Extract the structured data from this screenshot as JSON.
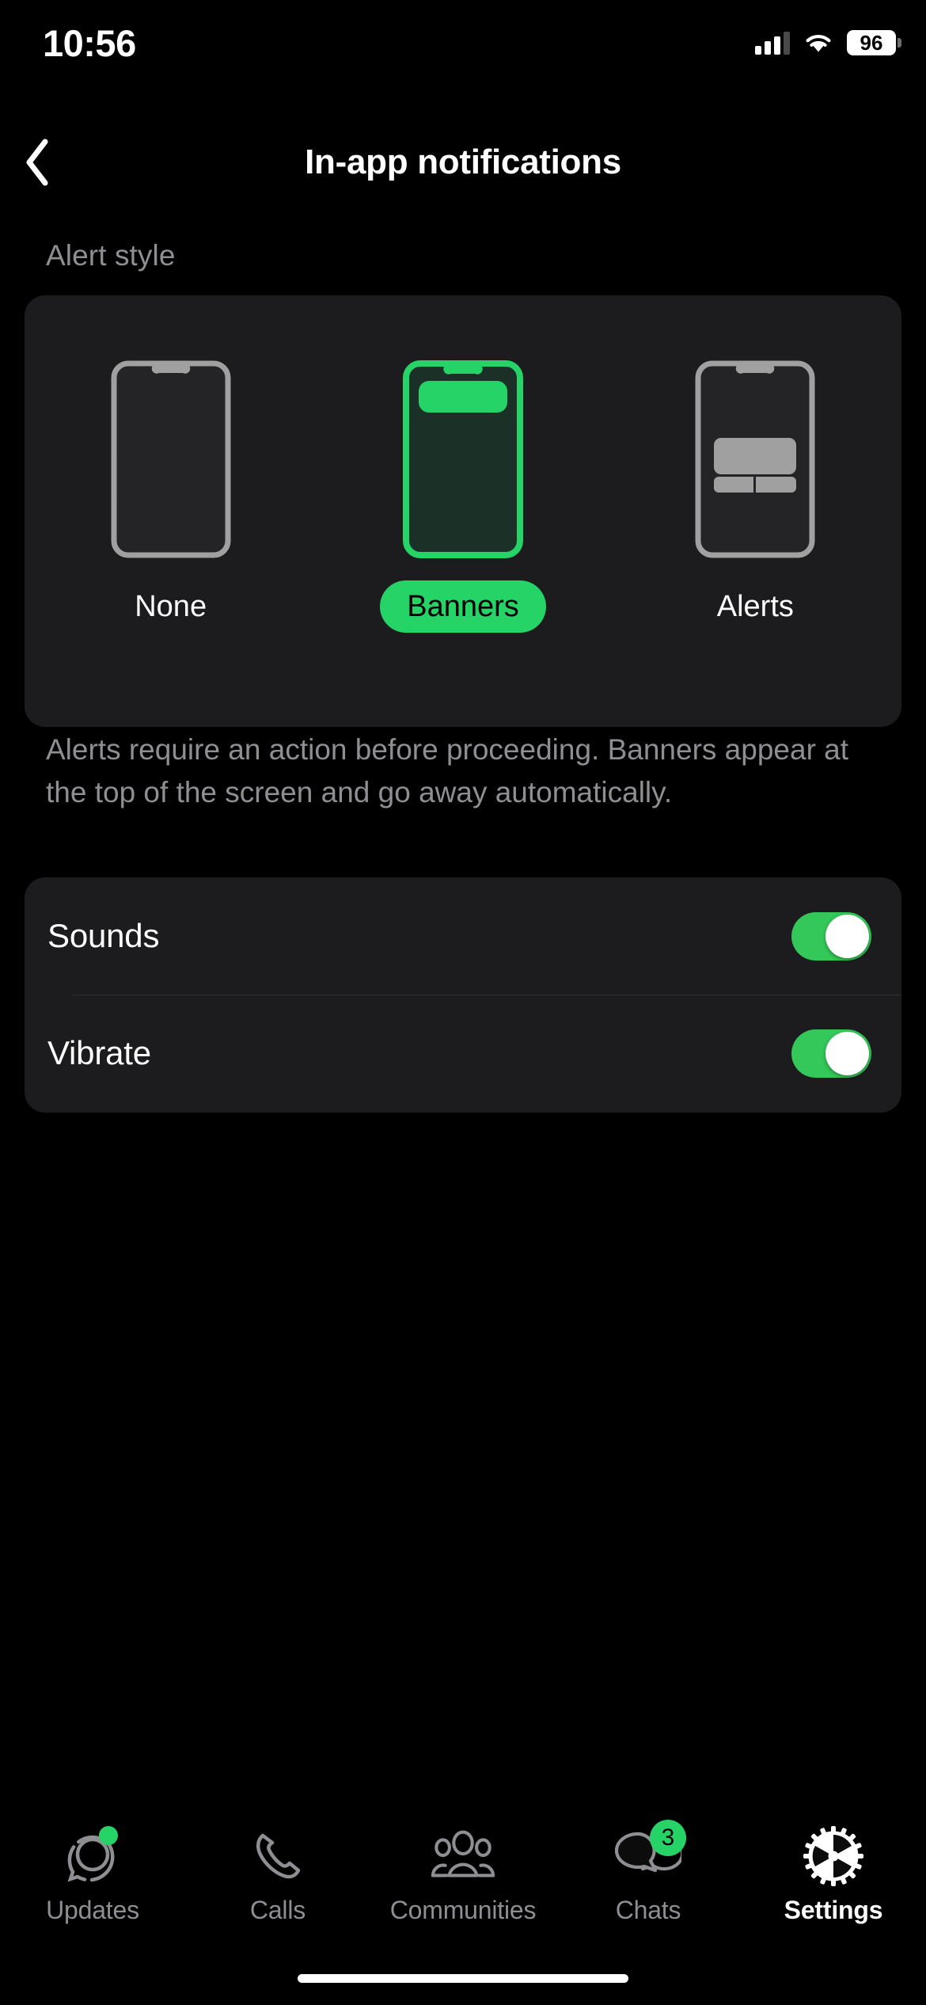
{
  "status_bar": {
    "time": "10:56",
    "cellular_icon": "cellular-bars-icon",
    "wifi_icon": "wifi-icon",
    "battery_percent": "96"
  },
  "nav": {
    "back_icon": "chevron-left-icon",
    "title": "In-app notifications"
  },
  "alert_style": {
    "section_header": "Alert style",
    "options": [
      {
        "label": "None",
        "selected": false,
        "phone_variant": "empty"
      },
      {
        "label": "Banners",
        "selected": true,
        "phone_variant": "banner"
      },
      {
        "label": "Alerts",
        "selected": false,
        "phone_variant": "alert"
      }
    ],
    "description": "Alerts require an action before proceeding. Banners appear at the top of the screen and go away automatically."
  },
  "settings_rows": [
    {
      "label": "Sounds",
      "toggle": "on"
    },
    {
      "label": "Vibrate",
      "toggle": "on"
    }
  ],
  "tab_bar": {
    "items": [
      {
        "label": "Updates",
        "icon": "status-ring-icon",
        "active": false,
        "dot": true,
        "badge": ""
      },
      {
        "label": "Calls",
        "icon": "phone-icon",
        "active": false,
        "dot": false,
        "badge": ""
      },
      {
        "label": "Communities",
        "icon": "people-group-icon",
        "active": false,
        "dot": false,
        "badge": ""
      },
      {
        "label": "Chats",
        "icon": "chat-bubbles-icon",
        "active": false,
        "dot": false,
        "badge": "3"
      },
      {
        "label": "Settings",
        "icon": "gear-icon",
        "active": true,
        "dot": false,
        "badge": ""
      }
    ]
  },
  "colors": {
    "background": "#000000",
    "card": "#1c1c1e",
    "accent_green": "#25d366",
    "toggle_green": "#34c759",
    "secondary_text": "#8e8e93",
    "outline_gray": "#a0a0a0"
  }
}
